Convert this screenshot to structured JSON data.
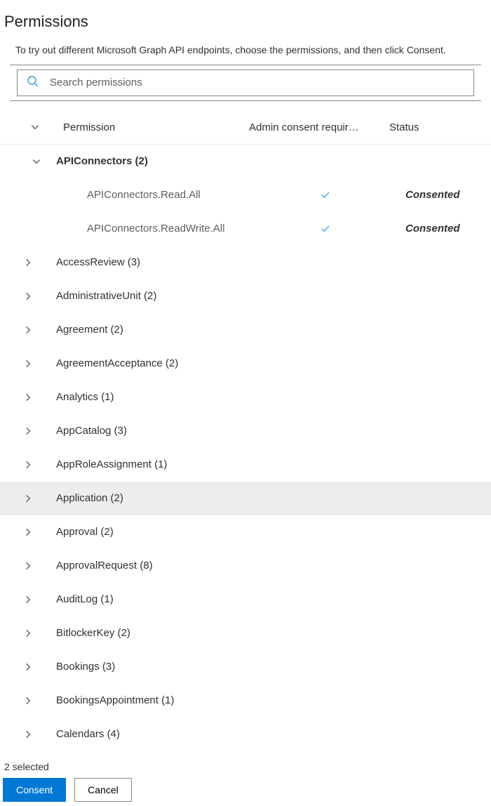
{
  "title": "Permissions",
  "subtitle": "To try out different Microsoft Graph API endpoints, choose the permissions, and then click Consent.",
  "search": {
    "placeholder": "Search permissions"
  },
  "columns": {
    "permission": "Permission",
    "admin": "Admin consent requir…",
    "status": "Status"
  },
  "groups": [
    {
      "name": "APIConnectors",
      "count": 2,
      "expanded": true,
      "permissions": [
        {
          "name": "APIConnectors.Read.All",
          "admin_required": true,
          "status": "Consented"
        },
        {
          "name": "APIConnectors.ReadWrite.All",
          "admin_required": true,
          "status": "Consented"
        }
      ]
    },
    {
      "name": "AccessReview",
      "count": 3,
      "expanded": false
    },
    {
      "name": "AdministrativeUnit",
      "count": 2,
      "expanded": false
    },
    {
      "name": "Agreement",
      "count": 2,
      "expanded": false
    },
    {
      "name": "AgreementAcceptance",
      "count": 2,
      "expanded": false
    },
    {
      "name": "Analytics",
      "count": 1,
      "expanded": false
    },
    {
      "name": "AppCatalog",
      "count": 3,
      "expanded": false
    },
    {
      "name": "AppRoleAssignment",
      "count": 1,
      "expanded": false
    },
    {
      "name": "Application",
      "count": 2,
      "expanded": false,
      "selected": true
    },
    {
      "name": "Approval",
      "count": 2,
      "expanded": false
    },
    {
      "name": "ApprovalRequest",
      "count": 8,
      "expanded": false
    },
    {
      "name": "AuditLog",
      "count": 1,
      "expanded": false
    },
    {
      "name": "BitlockerKey",
      "count": 2,
      "expanded": false
    },
    {
      "name": "Bookings",
      "count": 3,
      "expanded": false
    },
    {
      "name": "BookingsAppointment",
      "count": 1,
      "expanded": false
    },
    {
      "name": "Calendars",
      "count": 4,
      "expanded": false
    }
  ],
  "footer": {
    "selected_text": "2 selected",
    "consent": "Consent",
    "cancel": "Cancel"
  }
}
